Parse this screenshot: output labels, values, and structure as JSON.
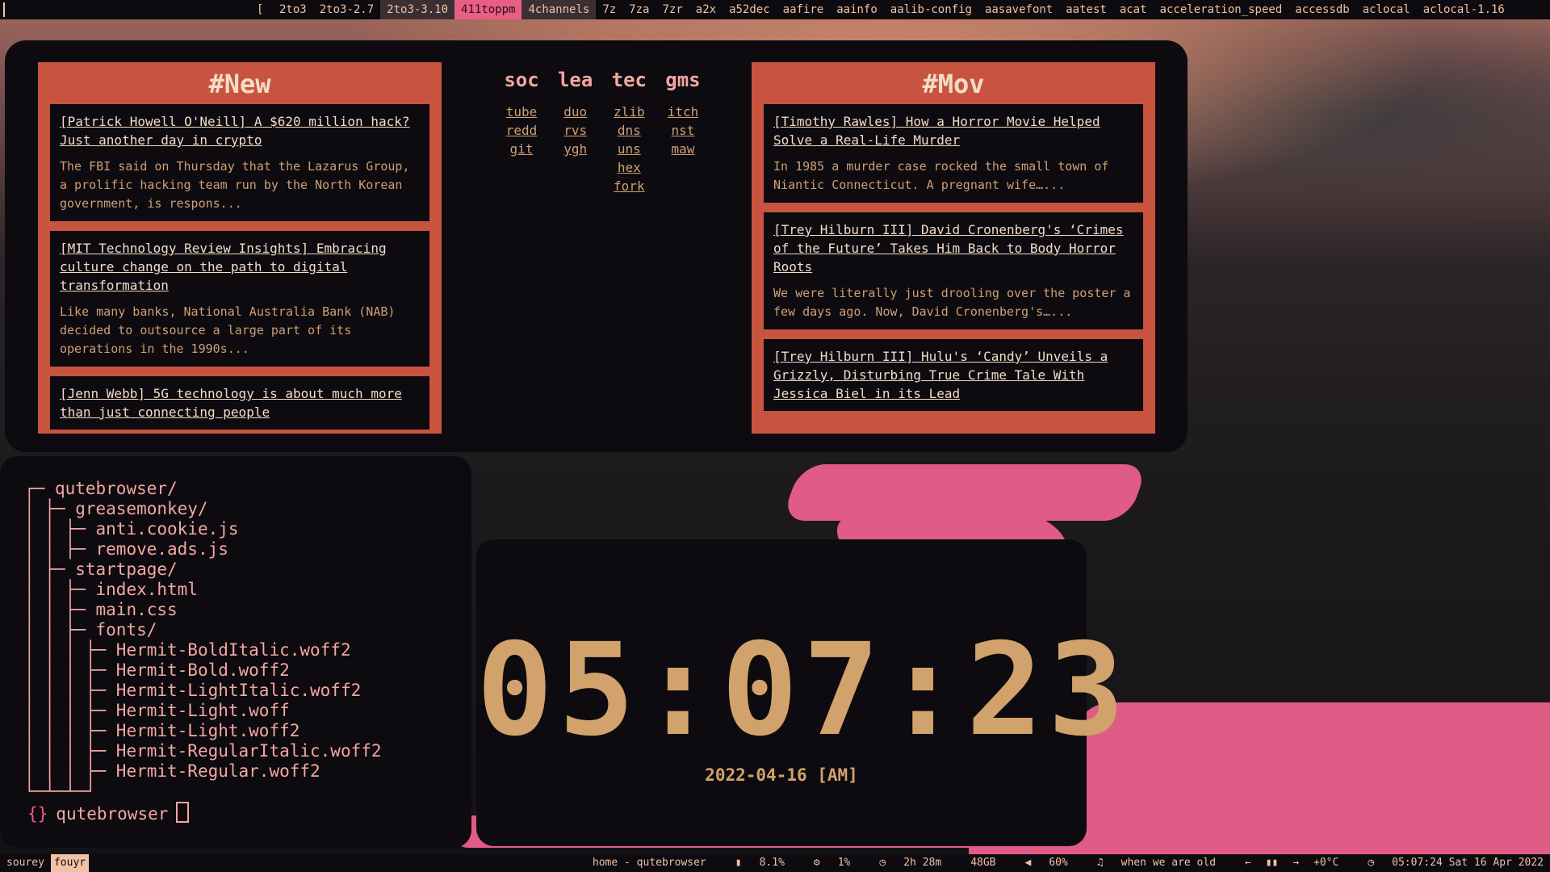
{
  "topbar": {
    "bracket": "[",
    "tags": [
      {
        "label": "2to3",
        "state": "normal"
      },
      {
        "label": "2to3-2.7",
        "state": "normal"
      },
      {
        "label": "2to3-3.10",
        "state": "current"
      },
      {
        "label": "411toppm",
        "state": "urgent"
      },
      {
        "label": "4channels",
        "state": "current"
      },
      {
        "label": "7z",
        "state": "normal"
      },
      {
        "label": "7za",
        "state": "normal"
      },
      {
        "label": "7zr",
        "state": "normal"
      },
      {
        "label": "a2x",
        "state": "normal"
      },
      {
        "label": "a52dec",
        "state": "normal"
      },
      {
        "label": "aafire",
        "state": "normal"
      },
      {
        "label": "aainfo",
        "state": "normal"
      },
      {
        "label": "aalib-config",
        "state": "normal"
      },
      {
        "label": "aasavefont",
        "state": "normal"
      },
      {
        "label": "aatest",
        "state": "normal"
      },
      {
        "label": "acat",
        "state": "normal"
      },
      {
        "label": "acceleration_speed",
        "state": "normal"
      },
      {
        "label": "accessdb",
        "state": "normal"
      },
      {
        "label": "aclocal",
        "state": "normal"
      },
      {
        "label": "aclocal-1.16",
        "state": "normal"
      }
    ]
  },
  "startpage": {
    "left": {
      "title": "#New",
      "cards": [
        {
          "title": "[Patrick Howell O'Neill] A $620 million hack? Just another day in crypto",
          "desc": "The FBI said on Thursday that the Lazarus Group, a prolific hacking team run by the North Korean government, is respons..."
        },
        {
          "title": "[MIT Technology Review Insights] Embracing culture change on the path to digital transformation",
          "desc": "Like many banks, National Australia Bank (NAB) decided to outsource a large part of its operations in the 1990s..."
        },
        {
          "title": "[Jenn Webb] 5G technology is about much more than just connecting people",
          "desc": ""
        }
      ]
    },
    "right": {
      "title": "#Mov",
      "cards": [
        {
          "title": "[Timothy Rawles] How a Horror Movie Helped Solve a Real-Life Murder",
          "desc": "In 1985 a murder case rocked the small town of Niantic Connecticut. A pregnant wife…..."
        },
        {
          "title": "[Trey Hilburn III] David Cronenberg's ‘Crimes of the Future’ Takes Him Back to Body Horror Roots",
          "desc": "We were literally just drooling over the poster a few days ago. Now, David Cronenberg's…..."
        },
        {
          "title": "[Trey Hilburn III] Hulu's ‘Candy’ Unveils a Grizzly, Disturbing True Crime Tale With Jessica Biel in its Lead",
          "desc": ""
        }
      ]
    },
    "links": [
      {
        "head": "soc",
        "items": [
          "tube",
          "redd",
          "git"
        ]
      },
      {
        "head": "lea",
        "items": [
          "duo",
          "rvs",
          "ygh"
        ]
      },
      {
        "head": "tec",
        "items": [
          "zlib",
          "dns",
          "uns",
          "hex",
          "fork"
        ]
      },
      {
        "head": "gms",
        "items": [
          "itch",
          "nst",
          "maw"
        ]
      }
    ]
  },
  "terminal": {
    "tree": [
      {
        "prefix": "┌─ ",
        "name": "qutebrowser/"
      },
      {
        "prefix": "│ ├─ ",
        "name": "greasemonkey/"
      },
      {
        "prefix": "│ │ ├─ ",
        "name": "anti.cookie.js"
      },
      {
        "prefix": "│ │ ├─ ",
        "name": "remove.ads.js"
      },
      {
        "prefix": "│ ├─ ",
        "name": "startpage/"
      },
      {
        "prefix": "│ │ ├─ ",
        "name": "index.html"
      },
      {
        "prefix": "│ │ ├─ ",
        "name": "main.css"
      },
      {
        "prefix": "│ │ ├─ ",
        "name": "fonts/"
      },
      {
        "prefix": "│ │ │ ├─ ",
        "name": "Hermit-BoldItalic.woff2"
      },
      {
        "prefix": "│ │ │ ├─ ",
        "name": "Hermit-Bold.woff2"
      },
      {
        "prefix": "│ │ │ ├─ ",
        "name": "Hermit-LightItalic.woff2"
      },
      {
        "prefix": "│ │ │ ├─ ",
        "name": "Hermit-Light.woff"
      },
      {
        "prefix": "│ │ │ ├─ ",
        "name": "Hermit-Light.woff2"
      },
      {
        "prefix": "│ │ │ ├─ ",
        "name": "Hermit-RegularItalic.woff2"
      },
      {
        "prefix": "│ │ │ ├─ ",
        "name": "Hermit-Regular.woff2"
      },
      {
        "prefix": "└─┴─┴─┘",
        "name": ""
      }
    ],
    "prompt_brace": "{}",
    "prompt_dir": "qutebrowser"
  },
  "clock": {
    "time": "05:07:23",
    "date": "2022-04-16 [AM]"
  },
  "bottombar": {
    "workspaces": [
      "sourey",
      "fouyr"
    ],
    "active_workspace": "fouyr",
    "window_title": "home - qutebrowser",
    "cpu": "8.1%",
    "memory": "1%",
    "uptime": "2h 28m",
    "disk": "48GB",
    "volume": "60%",
    "song": "when we are old",
    "temp": "+0°C",
    "datetime": "05:07:24 Sat 16 Apr 2022"
  },
  "colors": {
    "background": "#0d0b0f",
    "accent_red": "#c8543f",
    "text_light": "#f4dbc9",
    "text_tan": "#cf9f76",
    "pink": "#e85e84",
    "clock": "#d2a26c"
  }
}
